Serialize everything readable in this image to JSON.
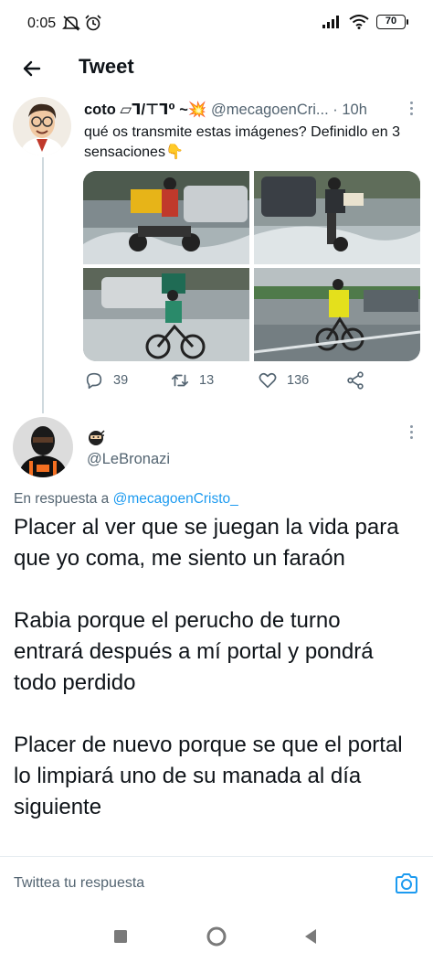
{
  "status_bar": {
    "time": "0:05",
    "battery": "70"
  },
  "header": {
    "title": "Tweet"
  },
  "tweet": {
    "display_name": "coto ▱ᒣ/⊤ᒣ⁰ ~💥",
    "handle": "@mecagoenCri...",
    "dot": "·",
    "time": "10h",
    "text": "qué os transmite estas imágenes? Definidlo en 3 sensaciones👇",
    "stats": {
      "replies": "39",
      "retweets": "13",
      "likes": "136"
    }
  },
  "reply": {
    "handle": "@LeBronazi",
    "in_reply_prefix": "En respuesta a",
    "in_reply_handle": "@mecagoenCristo_",
    "paragraphs": [
      "Placer al ver que se juegan la vida para que yo coma, me siento un faraón",
      "Rabia porque el perucho de turno entrará después a mí portal y pondrá todo perdido",
      "Placer de nuevo porque se que el portal lo limpiará uno de su manada al día siguiente"
    ]
  },
  "compose": {
    "placeholder": "Twittea tu respuesta"
  },
  "colors": {
    "accent": "#1d9bf0",
    "muted": "#536471",
    "text": "#0f1419",
    "thread_line": "#cfd9de"
  },
  "icons": [
    "back-arrow-icon",
    "more-icon",
    "reply-icon",
    "retweet-icon",
    "like-icon",
    "share-icon",
    "ninja-emoji-icon",
    "camera-icon",
    "nav-recents-icon",
    "nav-home-icon",
    "nav-back-icon"
  ]
}
